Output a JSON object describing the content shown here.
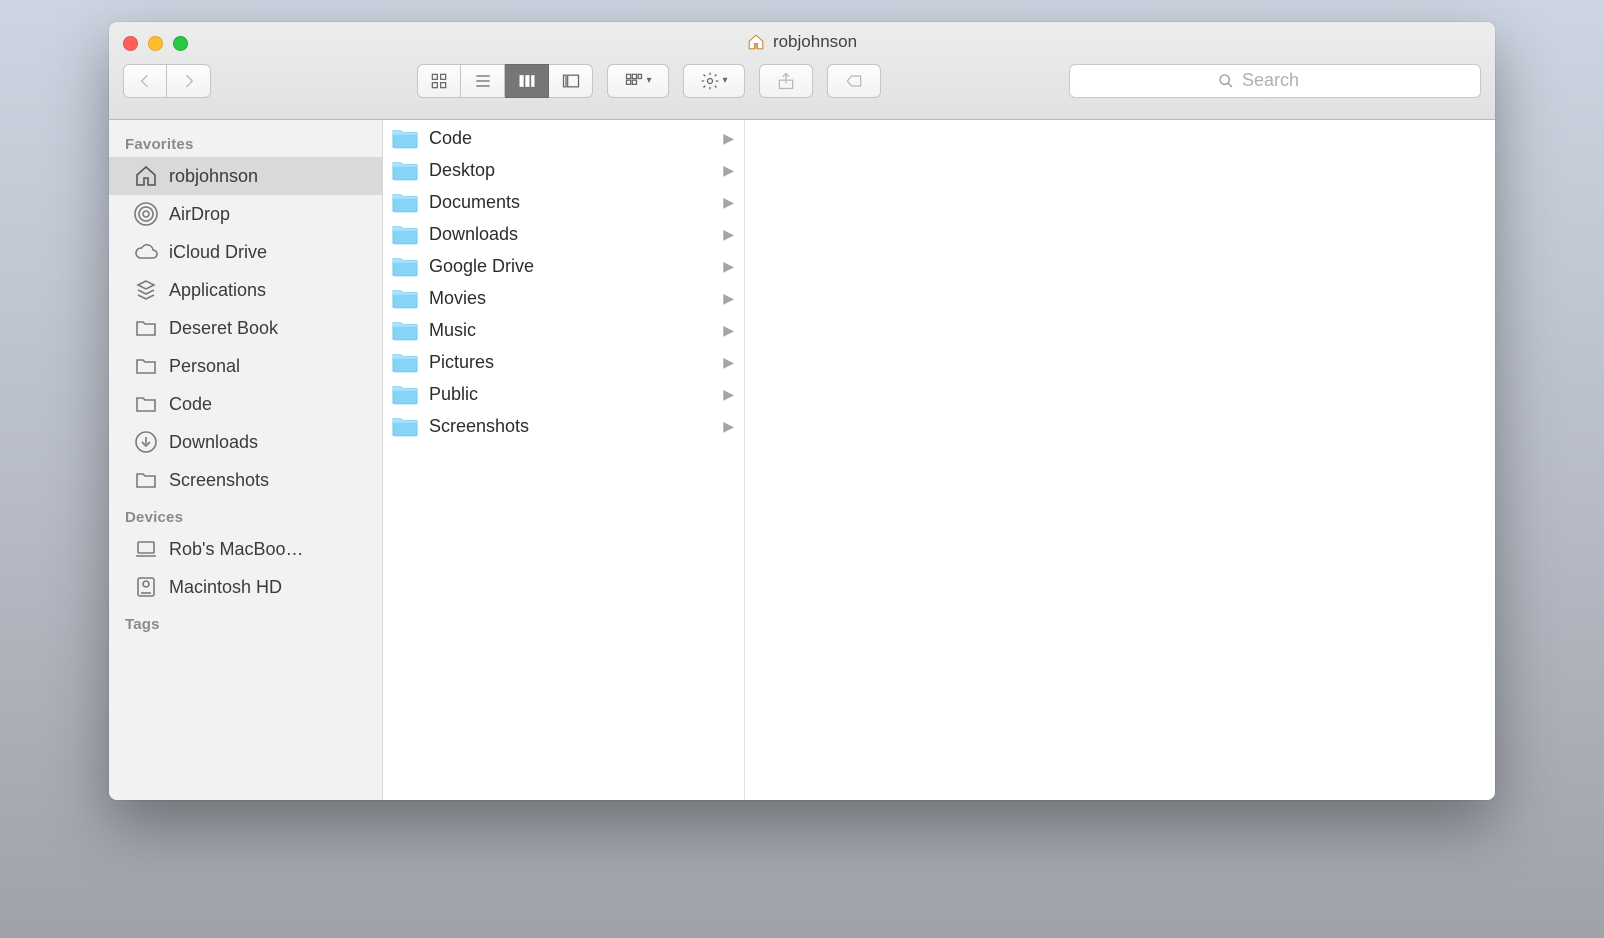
{
  "window": {
    "title": "robjohnson"
  },
  "search": {
    "placeholder": "Search"
  },
  "sidebar": {
    "sections": [
      {
        "heading": "Favorites",
        "items": [
          {
            "icon": "home",
            "label": "robjohnson",
            "selected": true
          },
          {
            "icon": "airdrop",
            "label": "AirDrop",
            "selected": false
          },
          {
            "icon": "cloud",
            "label": "iCloud Drive",
            "selected": false
          },
          {
            "icon": "apps",
            "label": "Applications",
            "selected": false
          },
          {
            "icon": "folder",
            "label": "Deseret Book",
            "selected": false
          },
          {
            "icon": "folder",
            "label": "Personal",
            "selected": false
          },
          {
            "icon": "folder",
            "label": "Code",
            "selected": false
          },
          {
            "icon": "download",
            "label": "Downloads",
            "selected": false
          },
          {
            "icon": "folder",
            "label": "Screenshots",
            "selected": false
          }
        ]
      },
      {
        "heading": "Devices",
        "items": [
          {
            "icon": "laptop",
            "label": "Rob's MacBoo…",
            "selected": false
          },
          {
            "icon": "disk",
            "label": "Macintosh HD",
            "selected": false
          }
        ]
      },
      {
        "heading": "Tags",
        "items": []
      }
    ]
  },
  "column": {
    "items": [
      {
        "name": "Code"
      },
      {
        "name": "Desktop"
      },
      {
        "name": "Documents"
      },
      {
        "name": "Downloads"
      },
      {
        "name": "Google Drive"
      },
      {
        "name": "Movies"
      },
      {
        "name": "Music"
      },
      {
        "name": "Pictures"
      },
      {
        "name": "Public"
      },
      {
        "name": "Screenshots"
      }
    ]
  }
}
